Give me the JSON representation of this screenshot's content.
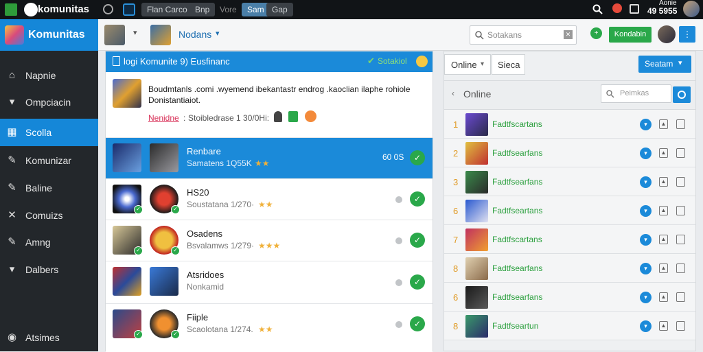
{
  "topbar": {
    "brand": "komunitas",
    "pills": [
      "Flan Carco",
      "Bnp",
      "Vore",
      "Sam",
      "Gap"
    ],
    "right_top": "Aonie",
    "right_count": "49 5955"
  },
  "sidebar": {
    "title": "Komunitas",
    "items": [
      {
        "label": "Napnie",
        "icon": "home-icon"
      },
      {
        "label": "Ompciacin",
        "icon": "inbox-icon"
      },
      {
        "label": "Scolla",
        "icon": "grid-icon",
        "active": true
      },
      {
        "label": "Komunizar",
        "icon": "wrench-icon"
      },
      {
        "label": "Baline",
        "icon": "wrench-icon"
      },
      {
        "label": "Comuizs",
        "icon": "tools-icon"
      },
      {
        "label": "Amng",
        "icon": "wrench-icon"
      },
      {
        "label": "Dalbers",
        "icon": "inbox-icon"
      }
    ],
    "footer": "Atsimes"
  },
  "header": {
    "title": "Nodans",
    "search_placeholder": "Sotakans",
    "green_button": "Kondabin"
  },
  "main": {
    "panel_title": "logi Komunite 9) Eusfinanc",
    "panel_status": "Sotakiol",
    "post_text": "Boudmtanls .comi .wyemend ibekantastr endrog .kaoclian ilaphe rohiole Donistantiaiot.",
    "post_link": "Nenidne",
    "post_meta": "Stoibledrase 1 30/0Hi:",
    "rows": [
      {
        "title": "Renbare",
        "sub": "Samatens 1Q55K",
        "stars": "★★",
        "value": "60 0S",
        "selected": true
      },
      {
        "title": "HS20",
        "sub": "Soustatana 1/270·",
        "stars": "★★"
      },
      {
        "title": "Osadens",
        "sub": "Bsvalamws 1/279·",
        "stars": "★★★"
      },
      {
        "title": "Atsridoes",
        "sub": "Nonkamid",
        "stars": ""
      },
      {
        "title": "Fiiple",
        "sub": "Scaolotana 1/274.",
        "stars": "★★"
      }
    ]
  },
  "right": {
    "dropdown": "Online",
    "tab2": "Sieca",
    "blue_button": "Seatam",
    "section_title": "Online",
    "search_placeholder": "Peimkas",
    "rows": [
      {
        "num": "1",
        "name": "Fadtfscartans"
      },
      {
        "num": "2",
        "name": "Fadtfsearfans"
      },
      {
        "num": "3",
        "name": "Fadtfsearfans"
      },
      {
        "num": "6",
        "name": "Fadtfseartans"
      },
      {
        "num": "7",
        "name": "Fadtfscartans"
      },
      {
        "num": "8",
        "name": "Fadtfsearfans"
      },
      {
        "num": "6",
        "name": "Fadtfsearfans"
      },
      {
        "num": "8",
        "name": "Fadtfseartun"
      }
    ]
  }
}
